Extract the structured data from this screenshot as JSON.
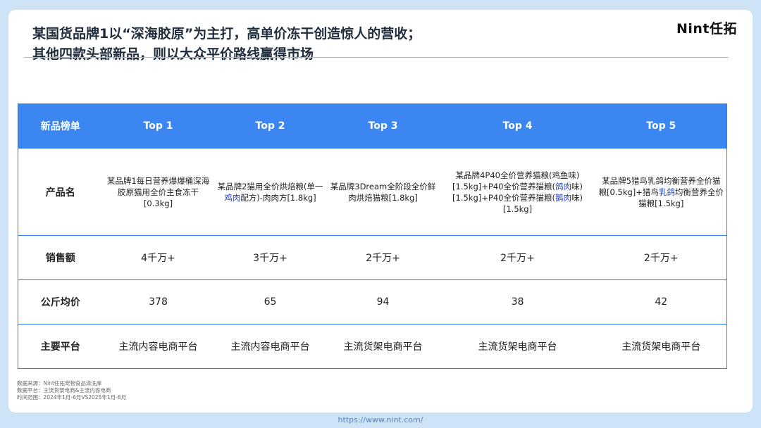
{
  "header": {
    "title_line1": "某国货品牌1以“深海胶原”为主打，高单价冻干创造惊人的营收；",
    "title_line2": "其他四款头部新品，则以大众平价路线赢得市场",
    "logo": "Nint任拓"
  },
  "table": {
    "columns": [
      "新品榜单",
      "Top 1",
      "Top 2",
      "Top 3",
      "Top 4",
      "Top 5"
    ],
    "row_labels": {
      "product": "产品名",
      "sales": "销售额",
      "price": "公斤均价",
      "platform": "主要平台"
    },
    "products": [
      {
        "a": "某品牌1每日营养爆爆桶深海胶原猫用全价主食冻干[0.3kg]",
        "hl": "",
        "b": ""
      },
      {
        "a": "某品牌2猫用全价烘焙粮(单一",
        "hl": "鸡肉",
        "b": "配方)-肉肉方[1.8kg]"
      },
      {
        "a": "某品牌3Dream全阶段全价鲜肉烘焙猫粮[1.8kg]",
        "hl": "",
        "b": ""
      },
      {
        "a": "某品牌4P40全价营养猫粮(鸡鱼味)[1.5kg]+P40全价营养猫粮(",
        "hl": "鸽肉",
        "b": "味)[1.5kg]+P40全价营养猫粮(",
        "hl2": "鹅肉",
        "c": "味)[1.5kg]"
      },
      {
        "a": "某品牌5猎鸟乳鸽均衡营养全价猫粮[0.5kg]+猎鸟",
        "hl": "乳鸽",
        "b": "均衡营养全价猫粮[1.5kg]"
      }
    ],
    "sales": [
      "4千万+",
      "3千万+",
      "2千万+",
      "2千万+",
      "2千万+"
    ],
    "price": [
      "378",
      "65",
      "94",
      "38",
      "42"
    ],
    "platform": [
      "主流内容电商平台",
      "主流内容电商平台",
      "主流货架电商平台",
      "主流货架电商平台",
      "主流货架电商平台"
    ]
  },
  "footer": {
    "source": "数据来源：Nint任拓宠物食品清洗库",
    "platform": "数据平台：主流货架电商&主流内容电商",
    "period": "时间范围：2024年1月-6月VS2025年1月-6月",
    "url": "https://www.nint.com/"
  },
  "colors": {
    "header_blue": "#3b86f0",
    "highlight": "#1f3cc7",
    "background": "#cfe3f7"
  }
}
